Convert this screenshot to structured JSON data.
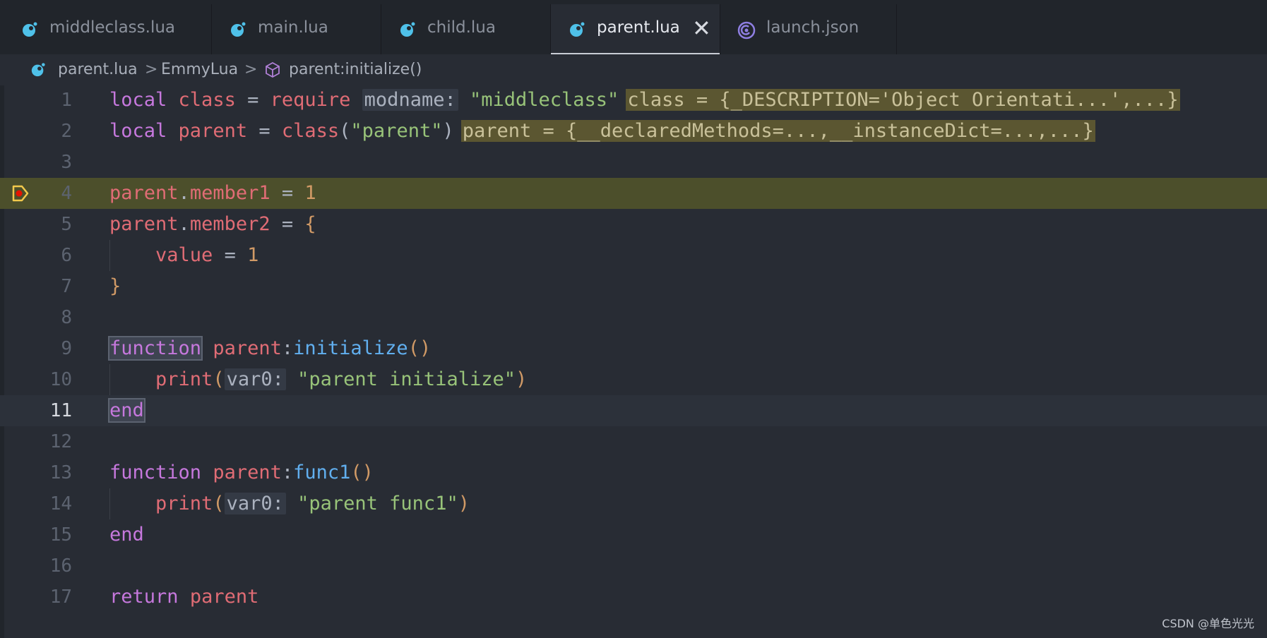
{
  "tabs": [
    {
      "label": "middleclass.lua",
      "icon": "lua-file-icon",
      "active": false
    },
    {
      "label": "main.lua",
      "icon": "lua-file-icon",
      "active": false
    },
    {
      "label": "child.lua",
      "icon": "lua-file-icon",
      "active": false
    },
    {
      "label": "parent.lua",
      "icon": "lua-file-icon",
      "active": true,
      "close": "✕"
    },
    {
      "label": "launch.json",
      "icon": "launch-config-icon",
      "active": false
    }
  ],
  "breadcrumb": {
    "file": "parent.lua",
    "scope": "EmmyLua",
    "symbol": "parent:initialize()",
    "sep": ">"
  },
  "editor": {
    "line_numbers": [
      "1",
      "2",
      "3",
      "4",
      "5",
      "6",
      "7",
      "8",
      "9",
      "10",
      "11",
      "12",
      "13",
      "14",
      "15",
      "16",
      "17"
    ],
    "current_line": "11",
    "breakpoint_line": "4",
    "inline_values": {
      "line1": "class = {_DESCRIPTION='Object Orientati...',...}",
      "line2": "parent = {__declaredMethods=...,__instanceDict=...,...}"
    },
    "param_hints": {
      "modname": "modname:",
      "var0": "var0:"
    }
  },
  "colors": {
    "keyword": "#c678dd",
    "variable": "#e06c75",
    "string": "#98c379",
    "number": "#d19a66",
    "function": "#61afef",
    "debug_line": "#4c4f2b",
    "breakpoint": "#f2c94c"
  },
  "watermark": "CSDN @单色光光"
}
